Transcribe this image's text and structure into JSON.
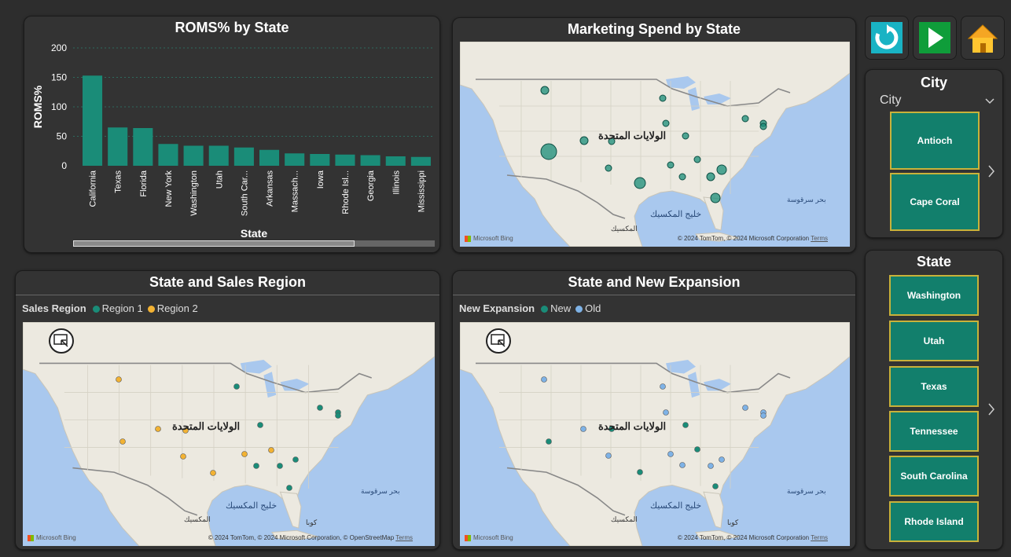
{
  "roms_chart": {
    "title": "ROMS% by State",
    "chart_data": {
      "type": "bar",
      "title": "ROMS% by State",
      "xlabel": "State",
      "ylabel": "ROMS%",
      "ylim": [
        0,
        200
      ],
      "yticks": [
        0,
        50,
        100,
        150,
        200
      ],
      "categories": [
        "California",
        "Texas",
        "Florida",
        "New York",
        "Washington",
        "Utah",
        "South Car...",
        "Arkansas",
        "Massach...",
        "Iowa",
        "Rhode Isl...",
        "Georgia",
        "Illinois",
        "Mississippi"
      ],
      "values": [
        153,
        65,
        64,
        37,
        34,
        34,
        31,
        27,
        21,
        20,
        19,
        18,
        16,
        15
      ],
      "color": "#1a8c78",
      "grid": true
    }
  },
  "marketing_map": {
    "title": "Marketing Spend by State",
    "country_label": "الولايات المتحدة",
    "gulf_label": "خليج المكسيك",
    "mexico_label": "المكسيك",
    "sea_label": "بحر سرقوسة",
    "bing": "Microsoft Bing",
    "copyright": "© 2024 TomTom, © 2024 Microsoft Corporation",
    "terms": "Terms"
  },
  "region_map": {
    "title": "State and Sales Region",
    "legend_title": "Sales Region",
    "legend": [
      {
        "name": "Region 1",
        "color": "#1a8c78"
      },
      {
        "name": "Region 2",
        "color": "#f2b233"
      }
    ],
    "country_label": "الولايات المتحدة",
    "gulf_label": "خليج المكسيك",
    "mexico_label": "المكسيك",
    "cuba_label": "كوبا",
    "sea_label": "بحر سرقوسة",
    "bing": "Microsoft Bing",
    "copyright": "© 2024 TomTom, © 2024 Microsoft Corporation, © OpenStreetMap",
    "terms": "Terms"
  },
  "expansion_map": {
    "title": "State and New Expansion",
    "legend_title": "New Expansion",
    "legend": [
      {
        "name": "New",
        "color": "#1a8c78"
      },
      {
        "name": "Old",
        "color": "#7eb2e6"
      }
    ],
    "country_label": "الولايات المتحدة",
    "gulf_label": "خليج المكسيك",
    "mexico_label": "المكسيك",
    "cuba_label": "كوبا",
    "sea_label": "بحر سرقوسة",
    "bing": "Microsoft Bing",
    "copyright": "© 2024 TomTom, © 2024 Microsoft Corporation",
    "terms": "Terms"
  },
  "toolbar": {
    "icons": [
      "refresh-icon",
      "play-icon",
      "home-icon"
    ]
  },
  "city_slicer": {
    "title": "City",
    "dropdown_label": "City",
    "items": [
      "Antioch",
      "Cape Coral"
    ]
  },
  "state_slicer": {
    "title": "State",
    "items": [
      "Washington",
      "Utah",
      "Texas",
      "Tennessee",
      "South Carolina",
      "Rhode Island"
    ]
  }
}
